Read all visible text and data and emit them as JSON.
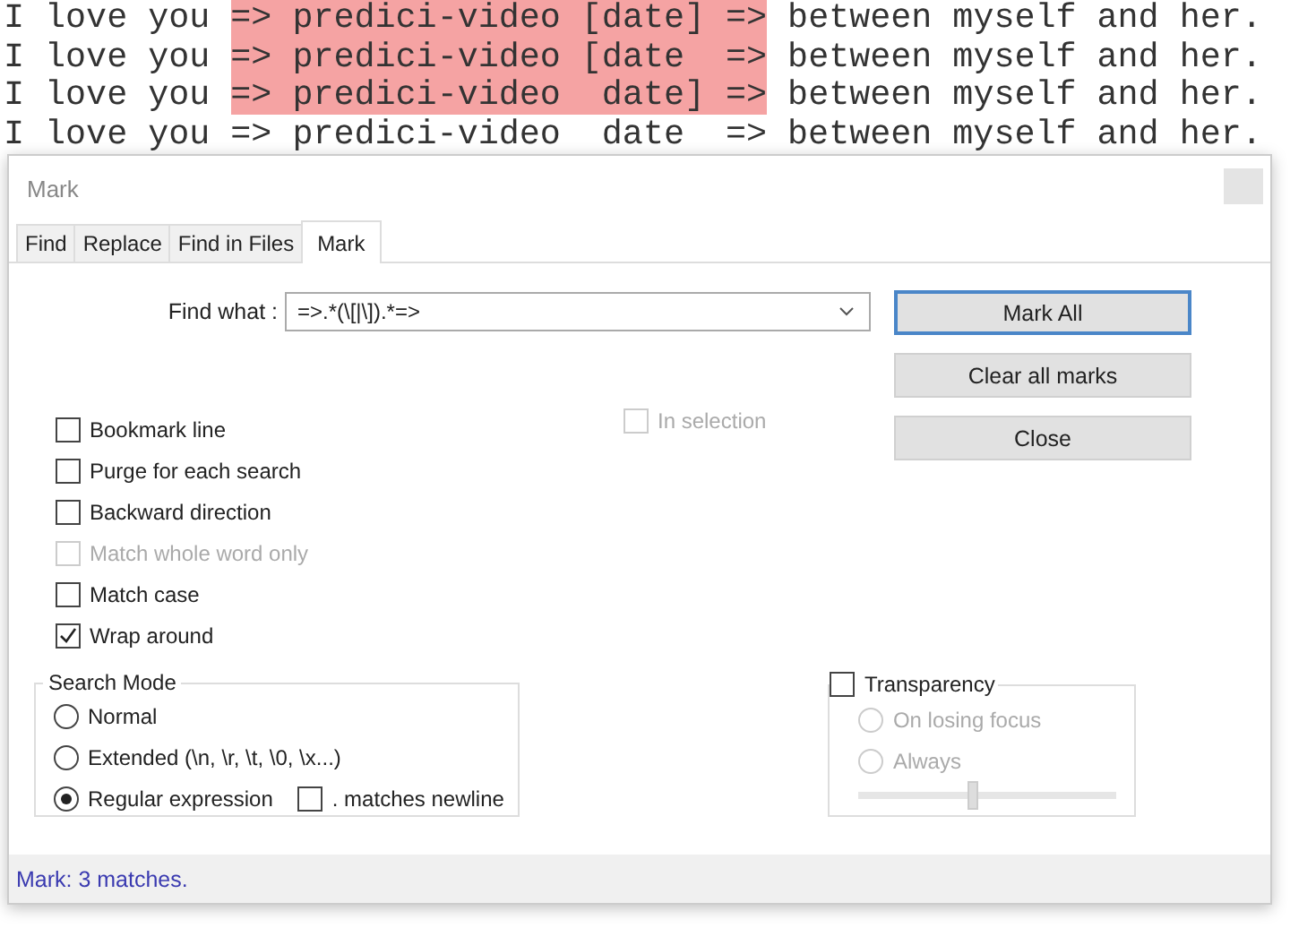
{
  "editor": {
    "lines": [
      {
        "segments": [
          {
            "text": "I love you ",
            "marked": false
          },
          {
            "text": "=> predici-video [date] =>",
            "marked": true
          },
          {
            "text": " between myself and her.",
            "marked": false
          }
        ]
      },
      {
        "segments": [
          {
            "text": "I love you ",
            "marked": false
          },
          {
            "text": "=> predici-video [date  =>",
            "marked": true
          },
          {
            "text": " between myself and her.",
            "marked": false
          }
        ]
      },
      {
        "segments": [
          {
            "text": "I love you ",
            "marked": false
          },
          {
            "text": "=> predici-video  date] =>",
            "marked": true
          },
          {
            "text": " between myself and her.",
            "marked": false
          }
        ]
      },
      {
        "segments": [
          {
            "text": "I love you => predici-video  date  => between myself and her.",
            "marked": false
          }
        ]
      }
    ]
  },
  "dialog": {
    "title": "Mark",
    "tabs": [
      {
        "label": "Find",
        "selected": false
      },
      {
        "label": "Replace",
        "selected": false
      },
      {
        "label": "Find in Files",
        "selected": false
      },
      {
        "label": "Mark",
        "selected": true
      }
    ],
    "find_what": {
      "label": "Find what :",
      "value": "=>.*(\\[|\\]).*=>"
    },
    "buttons": [
      {
        "label": "Mark All",
        "default": true
      },
      {
        "label": "Clear all marks",
        "default": false
      },
      {
        "label": "Close",
        "default": false
      }
    ],
    "in_selection": {
      "label": "In selection",
      "checked": false,
      "disabled": true
    },
    "options": [
      {
        "label": "Bookmark line",
        "checked": false,
        "disabled": false
      },
      {
        "label": "Purge for each search",
        "checked": false,
        "disabled": false
      },
      {
        "label": "Backward direction",
        "checked": false,
        "disabled": false
      },
      {
        "label": "Match whole word only",
        "checked": false,
        "disabled": true
      },
      {
        "label": "Match case",
        "checked": false,
        "disabled": false
      },
      {
        "label": "Wrap around",
        "checked": true,
        "disabled": false
      }
    ],
    "search_mode": {
      "title": "Search Mode",
      "options": [
        {
          "label": "Normal",
          "selected": false
        },
        {
          "label": "Extended (\\n, \\r, \\t, \\0, \\x...)",
          "selected": false
        },
        {
          "label": "Regular expression",
          "selected": true
        }
      ],
      "dot_newline": {
        "label": ". matches newline",
        "checked": false
      }
    },
    "transparency": {
      "label": "Transparency",
      "checked": false,
      "options": [
        {
          "label": "On losing focus",
          "selected": false,
          "disabled": true
        },
        {
          "label": "Always",
          "selected": false,
          "disabled": true
        }
      ],
      "level": 0.44
    },
    "status": "Mark: 3 matches."
  }
}
